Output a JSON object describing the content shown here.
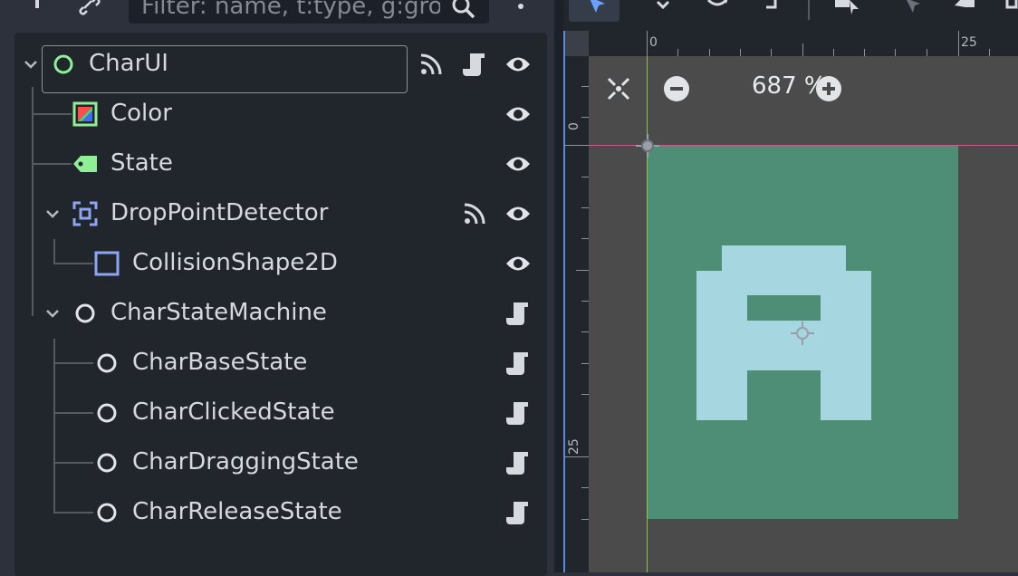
{
  "scene_dock": {
    "filter": {
      "placeholder": "Filter: name, t:type, g:gro",
      "value": ""
    },
    "tree": [
      {
        "label": "CharUI",
        "icon": "control-node-icon",
        "expanded": true,
        "selected": true,
        "actions": [
          "signal-icon",
          "script-icon",
          "visibility-icon"
        ]
      },
      {
        "label": "Color",
        "icon": "color-rect-icon",
        "actions": [
          "visibility-icon"
        ]
      },
      {
        "label": "State",
        "icon": "label-node-icon",
        "actions": [
          "visibility-icon"
        ]
      },
      {
        "label": "DropPointDetector",
        "icon": "area2d-icon",
        "expanded": true,
        "actions": [
          "signal-icon",
          "visibility-icon"
        ]
      },
      {
        "label": "CollisionShape2D",
        "icon": "collision-shape-icon",
        "actions": [
          "visibility-icon"
        ]
      },
      {
        "label": "CharStateMachine",
        "icon": "node-icon",
        "expanded": true,
        "actions": [
          "script-icon"
        ]
      },
      {
        "label": "CharBaseState",
        "icon": "node-icon",
        "actions": [
          "script-icon"
        ]
      },
      {
        "label": "CharClickedState",
        "icon": "node-icon",
        "actions": [
          "script-icon"
        ]
      },
      {
        "label": "CharDraggingState",
        "icon": "node-icon",
        "actions": [
          "script-icon"
        ]
      },
      {
        "label": "CharReleaseState",
        "icon": "node-icon",
        "actions": [
          "script-icon"
        ]
      }
    ]
  },
  "viewport": {
    "zoom_label": "687 %",
    "ruler_top_labels": [
      "0",
      "25"
    ],
    "ruler_left_labels": [
      "0",
      "25"
    ]
  },
  "colors": {
    "panel_bg": "#21252c",
    "dock_bg": "#2c313b",
    "canvas_fill": "#4e8e76",
    "glyph_fill": "#a6d6e0",
    "control_icon": "#8eef97",
    "node2d_icon": "#8da5f3"
  }
}
